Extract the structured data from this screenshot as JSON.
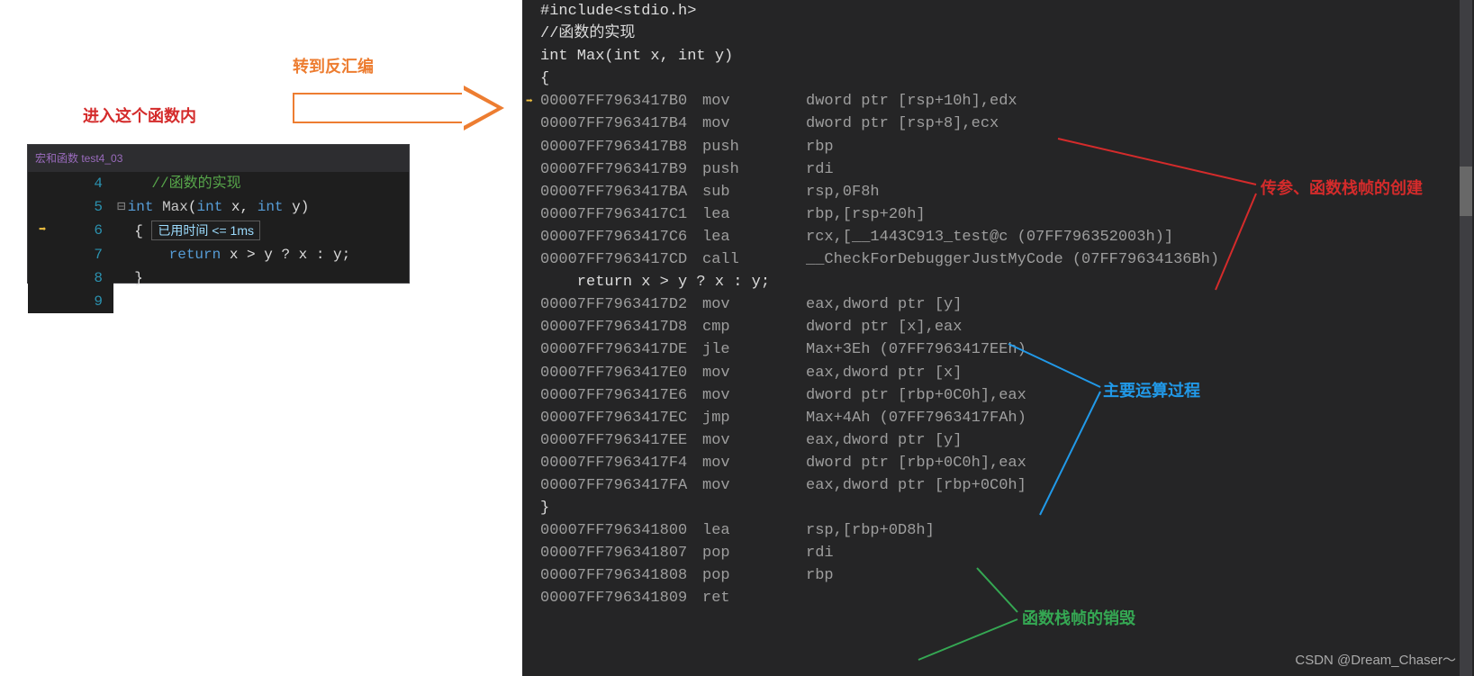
{
  "labels": {
    "enterFunc": "进入这个函数内",
    "gotoDisasm": "转到反汇编",
    "stackCreate": "传参、函数栈帧的创建",
    "calcProcess": "主要运算过程",
    "stackDestroy": "函数栈帧的销毁"
  },
  "editor": {
    "title": "宏和函数 test4_03",
    "timerLabel": "已用时间 <= 1ms",
    "lines": {
      "l4": {
        "num": "4",
        "comment": "//函数的实现"
      },
      "l5": {
        "num": "5",
        "kw": "int",
        "fn": "Max",
        "kw2": "int",
        "p1": "x",
        "kw3": "int",
        "p2": "y"
      },
      "l6": {
        "num": "6",
        "brace": "{"
      },
      "l7": {
        "num": "7",
        "kw": "return",
        "expr": "x > y ? x : y;"
      },
      "l8": {
        "num": "8",
        "brace": "}"
      },
      "l9": {
        "num": "9"
      }
    }
  },
  "disasm": {
    "src": {
      "include": "#include<stdio.h>",
      "comment": "//函数的实现",
      "sig": "int Max(int x, int y)",
      "open": "{",
      "return": "    return x > y ? x : y;",
      "close": "}"
    },
    "rows": [
      {
        "addr": "00007FF7963417B0",
        "op": "mov",
        "args": "dword ptr [rsp+10h],edx",
        "cursor": true
      },
      {
        "addr": "00007FF7963417B4",
        "op": "mov",
        "args": "dword ptr [rsp+8],ecx"
      },
      {
        "addr": "00007FF7963417B8",
        "op": "push",
        "args": "rbp"
      },
      {
        "addr": "00007FF7963417B9",
        "op": "push",
        "args": "rdi"
      },
      {
        "addr": "00007FF7963417BA",
        "op": "sub",
        "args": "rsp,0F8h"
      },
      {
        "addr": "00007FF7963417C1",
        "op": "lea",
        "args": "rbp,[rsp+20h]"
      },
      {
        "addr": "00007FF7963417C6",
        "op": "lea",
        "args": "rcx,[__1443C913_test@c (07FF796352003h)]"
      },
      {
        "addr": "00007FF7963417CD",
        "op": "call",
        "args": "__CheckForDebuggerJustMyCode (07FF79634136Bh)"
      },
      {
        "addr": "00007FF7963417D2",
        "op": "mov",
        "args": "eax,dword ptr [y]"
      },
      {
        "addr": "00007FF7963417D8",
        "op": "cmp",
        "args": "dword ptr [x],eax"
      },
      {
        "addr": "00007FF7963417DE",
        "op": "jle",
        "args": "Max+3Eh (07FF7963417EEh)"
      },
      {
        "addr": "00007FF7963417E0",
        "op": "mov",
        "args": "eax,dword ptr [x]"
      },
      {
        "addr": "00007FF7963417E6",
        "op": "mov",
        "args": "dword ptr [rbp+0C0h],eax"
      },
      {
        "addr": "00007FF7963417EC",
        "op": "jmp",
        "args": "Max+4Ah (07FF7963417FAh)"
      },
      {
        "addr": "00007FF7963417EE",
        "op": "mov",
        "args": "eax,dword ptr [y]"
      },
      {
        "addr": "00007FF7963417F4",
        "op": "mov",
        "args": "dword ptr [rbp+0C0h],eax"
      },
      {
        "addr": "00007FF7963417FA",
        "op": "mov",
        "args": "eax,dword ptr [rbp+0C0h]"
      },
      {
        "addr": "00007FF796341800",
        "op": "lea",
        "args": "rsp,[rbp+0D8h]"
      },
      {
        "addr": "00007FF796341807",
        "op": "pop",
        "args": "rdi"
      },
      {
        "addr": "00007FF796341808",
        "op": "pop",
        "args": "rbp"
      },
      {
        "addr": "00007FF796341809",
        "op": "ret",
        "args": ""
      }
    ]
  },
  "watermark": "CSDN @Dream_Chaser～"
}
